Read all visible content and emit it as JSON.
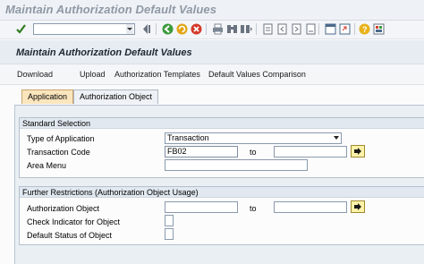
{
  "window": {
    "title": "Maintain Authorization Default Values"
  },
  "toolbar": {
    "icons": [
      "enter-icon",
      "command-field",
      "save-icon",
      "back-icon",
      "exit-icon",
      "cancel-icon",
      "print-icon",
      "find-icon",
      "find-next-icon",
      "first-page-icon",
      "previous-page-icon",
      "next-page-icon",
      "last-page-icon",
      "create-session-icon",
      "shortcut-icon",
      "help-icon",
      "layout-icon"
    ],
    "accent": "#d9a219"
  },
  "screen": {
    "title": "Maintain Authorization Default Values"
  },
  "app_toolbar": {
    "buttons": [
      "Download",
      "Upload",
      "Authorization Templates",
      "Default Values Comparison"
    ]
  },
  "tabs": [
    {
      "label": "Application",
      "active": true
    },
    {
      "label": "Authorization Object",
      "active": false
    }
  ],
  "standard_selection": {
    "title": "Standard Selection",
    "type_of_application": {
      "label": "Type of Application",
      "value": "Transaction"
    },
    "transaction_code": {
      "label": "Transaction Code",
      "value": "FB02",
      "to_label": "to",
      "to_value": ""
    },
    "area_menu": {
      "label": "Area Menu",
      "value": ""
    }
  },
  "further_restrictions": {
    "title": "Further Restrictions (Authorization Object Usage)",
    "authorization_object": {
      "label": "Authorization Object",
      "value": "",
      "to_label": "to",
      "to_value": ""
    },
    "check_indicator": {
      "label": "Check Indicator for Object",
      "value": ""
    },
    "default_status": {
      "label": "Default Status of Object",
      "value": ""
    }
  }
}
